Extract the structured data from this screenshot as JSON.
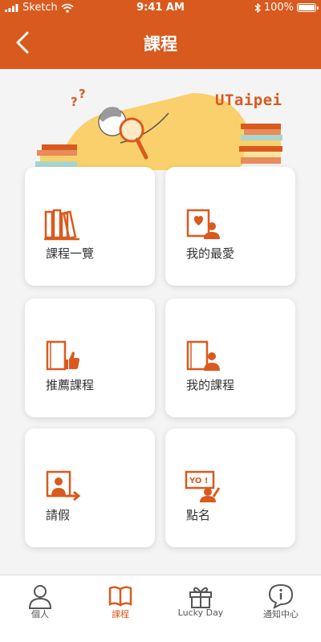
{
  "status_bar": {
    "carrier": "Sketch",
    "time": "9:41 AM",
    "battery": "100%"
  },
  "header": {
    "title": "課程",
    "back_icon": "chevron-left-icon"
  },
  "banner": {
    "brand": "UTaipei"
  },
  "menu": [
    {
      "label": "課程一覽",
      "icon": "books-icon"
    },
    {
      "label": "我的最愛",
      "icon": "favorite-person-icon"
    },
    {
      "label": "推薦課程",
      "icon": "thumbs-up-book-icon"
    },
    {
      "label": "我的課程",
      "icon": "person-book-icon"
    },
    {
      "label": "請假",
      "icon": "leave-icon"
    },
    {
      "label": "點名",
      "icon": "roll-call-icon"
    }
  ],
  "tab_bar": {
    "items": [
      {
        "label": "個人",
        "icon": "person-icon",
        "active": false
      },
      {
        "label": "課程",
        "icon": "book-icon",
        "active": true
      },
      {
        "label": "Lucky Day",
        "icon": "gift-icon",
        "active": false
      },
      {
        "label": "通知中心",
        "icon": "info-chat-icon",
        "active": false
      }
    ]
  },
  "colors": {
    "primary": "#d95a1e",
    "background": "#f4f4f4",
    "card": "#ffffff",
    "illustration_yellow": "#f9d06b"
  }
}
